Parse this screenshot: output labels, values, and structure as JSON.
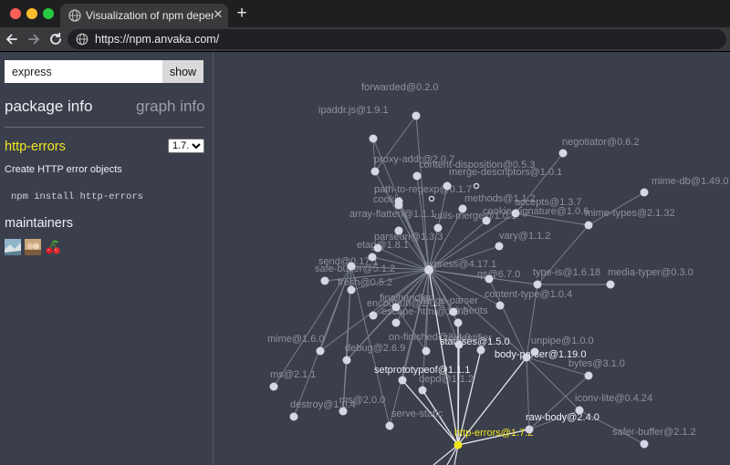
{
  "browser": {
    "tab_title": "Visualization of npm dependencies",
    "close_glyph": "✕",
    "new_tab_glyph": "+",
    "url": "https://npm.anvaka.com/"
  },
  "sidebar": {
    "search_value": "express",
    "show_label": "show",
    "tab_package": "package info",
    "tab_graph": "graph info",
    "package_name": "http-errors",
    "version_selected": "1.7.2",
    "description": "Create HTTP error objects",
    "install_command": "npm install http-errors",
    "maintainers_title": "maintainers",
    "maintainers": [
      "avatar-1",
      "avatar-2",
      "cherry-avatar"
    ]
  },
  "colors": {
    "background": "#3b3f4c",
    "node": "#d6d6e6",
    "edge": "#7f8493",
    "highlight_edge": "#e6e6ee",
    "active": "#f1e61e",
    "label": "#8d929d",
    "label_highlight": "#eef0f3"
  },
  "graph": {
    "labels": [
      "forwarded@0.2.0",
      "ipaddr.js@1.9.1",
      "proxy-addr@2.0.7",
      "content-disposition@0.5.3",
      "merge-descriptors@1.0.1",
      "negotiator@0.6.2",
      "mime-db@1.49.0",
      "path-to-regexp@0.1.7",
      "methods@1.1.2",
      "accepts@1.3.7",
      "cookie-signature@1.0.6",
      "mime-types@2.1.32",
      "array-flatten@1.1.1",
      "cookie",
      "vary@1.1.2",
      "express@4.17.1",
      "type-is@1.6.18",
      "media-typer@0.3.0",
      "content-type@1.0.4",
      "parseurl@1.3.3",
      "send@0.17.1",
      "safe-buffer@5.1.2",
      "finalhandler",
      "qs@6.7.0",
      "etag@1.8.1",
      "fresh@0.5.2",
      "encodeurl@1.0.2",
      "range-parser",
      "escape-html@1.0.3",
      "mime@1.6.0",
      "ms@2.1.1",
      "destroy@1.0.4",
      "ms@2.0.0",
      "debug@2.6.9",
      "depd@1.1.2",
      "on-finished@2.3.0",
      "statuses@1.5.0",
      "setprototypeof@1.1.1",
      "body-parser@1.19.0",
      "unpipe@1.0.0",
      "bytes@3.1.0",
      "iconv-lite@0.4.24",
      "raw-body@2.4.0",
      "safer-buffer@2.1.2",
      "http-errors@1.7.2",
      "inherits",
      "toidentifier",
      "serve-static",
      "utils-merge@1.0.1"
    ]
  }
}
